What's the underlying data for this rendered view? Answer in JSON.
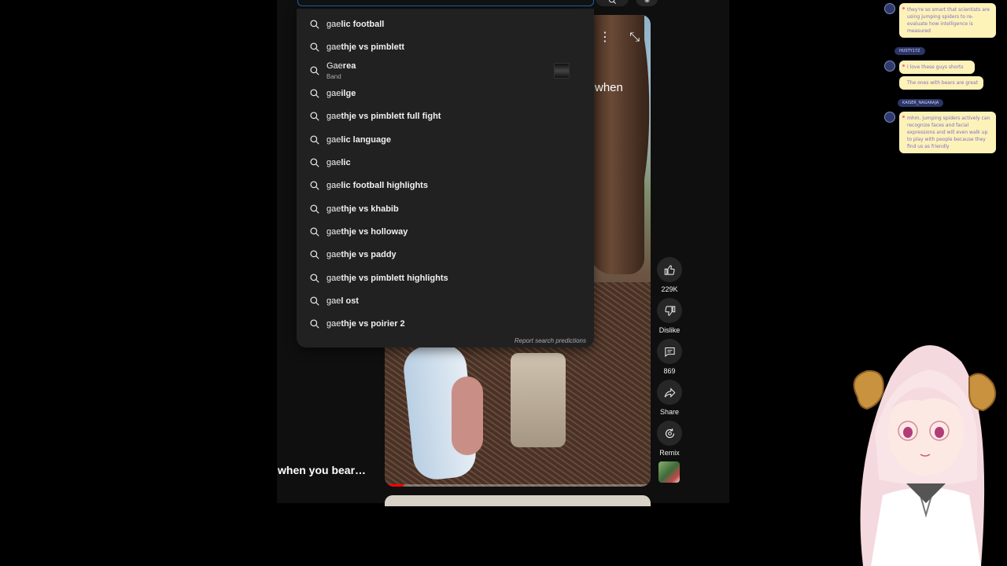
{
  "search": {
    "query_partial": "gae",
    "suggestions": [
      {
        "match": "gae",
        "rest": "lic football"
      },
      {
        "match": "gae",
        "rest": "thje vs pimblett"
      },
      {
        "match": "Gae",
        "rest": "rea",
        "sub": "Band"
      },
      {
        "match": "gae",
        "rest": "ilge"
      },
      {
        "match": "gae",
        "rest": "thje vs pimblett full fight"
      },
      {
        "match": "gae",
        "rest": "lic language"
      },
      {
        "match": "gae",
        "rest": "lic"
      },
      {
        "match": "gae",
        "rest": "lic football highlights"
      },
      {
        "match": "gae",
        "rest": "thje vs khabib"
      },
      {
        "match": "gae",
        "rest": "thje vs holloway"
      },
      {
        "match": "gae",
        "rest": "thje vs paddy"
      },
      {
        "match": "gae",
        "rest": "thje vs pimblett highlights"
      },
      {
        "match": "gae",
        "rest": "l ost"
      },
      {
        "match": "gae",
        "rest": "thje vs poirier 2"
      }
    ],
    "report_link": "Report search predictions"
  },
  "video": {
    "overlay_caption": "when",
    "title": "when you bear…",
    "progress_fraction": 0.07
  },
  "actions": {
    "like_count": "229K",
    "dislike_label": "Dislike",
    "comment_count": "869",
    "share_label": "Share",
    "remix_label": "Remix"
  },
  "chat": {
    "messages": [
      {
        "text": "they're so smart that scientists are using jumping spiders to re-evaluate how intelligence is measured"
      },
      {
        "name": "HUSTY17Z",
        "lines": [
          "I love these guys shorts",
          "The ones with bears are great"
        ]
      },
      {
        "name": "KAISER_NAGARAJA",
        "lines": [
          "mhm, jumping spiders actively can recognize faces and facial expressions and will even walk up to play with people because they find us as friendly"
        ]
      }
    ]
  },
  "colors": {
    "accent_red": "#ff0000",
    "dropdown_bg": "#212121",
    "chat_bubble": "#fdf2b8"
  }
}
